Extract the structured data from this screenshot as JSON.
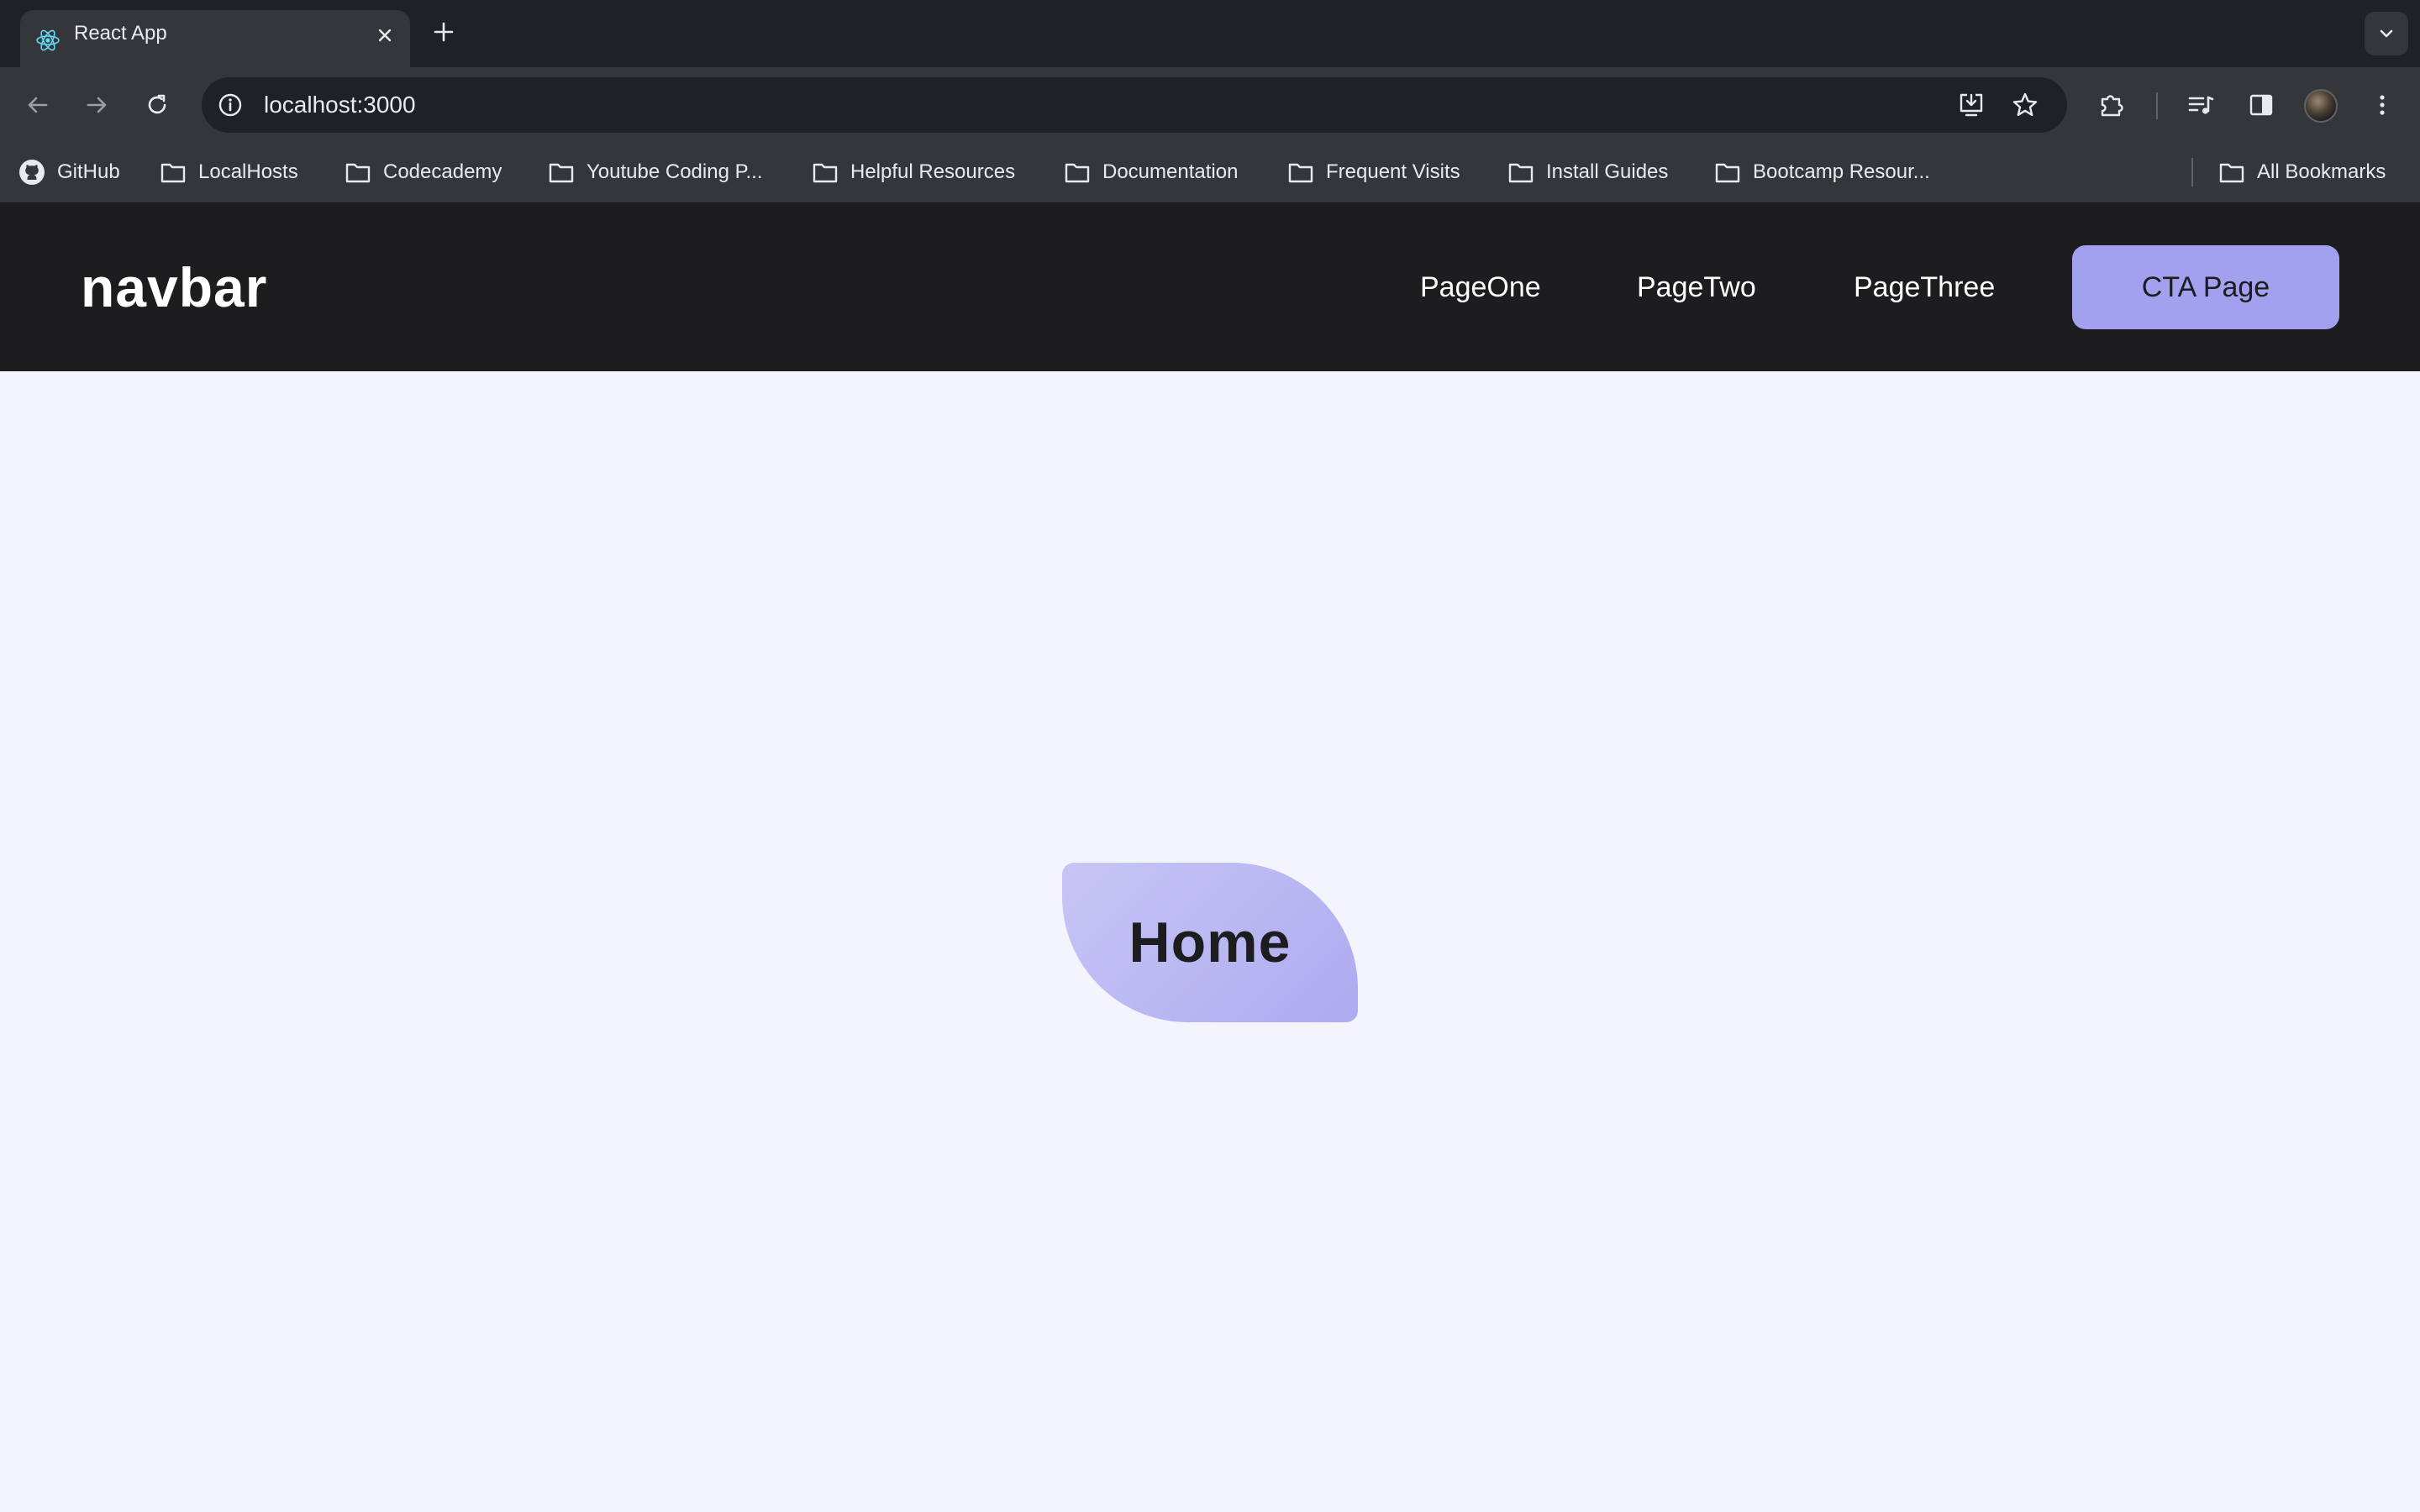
{
  "browser": {
    "tab": {
      "title": "React App",
      "favicon": "react-logo-icon"
    },
    "address_bar": {
      "url": "localhost:3000"
    },
    "bookmarks": [
      {
        "label": "GitHub",
        "icon": "github-icon"
      },
      {
        "label": "LocalHosts",
        "icon": "folder-icon"
      },
      {
        "label": "Codecademy",
        "icon": "folder-icon"
      },
      {
        "label": "Youtube Coding P...",
        "icon": "folder-icon"
      },
      {
        "label": "Helpful Resources",
        "icon": "folder-icon"
      },
      {
        "label": "Documentation",
        "icon": "folder-icon"
      },
      {
        "label": "Frequent Visits",
        "icon": "folder-icon"
      },
      {
        "label": "Install Guides",
        "icon": "folder-icon"
      },
      {
        "label": "Bootcamp Resour...",
        "icon": "folder-icon"
      }
    ],
    "all_bookmarks": {
      "label": "All Bookmarks",
      "icon": "folder-icon"
    }
  },
  "navbar": {
    "brand": "navbar",
    "links": [
      "PageOne",
      "PageTwo",
      "PageThree"
    ],
    "cta": "CTA Page"
  },
  "main": {
    "title": "Home"
  },
  "colors": {
    "nav_background": "#1d1d1f",
    "accent": "#a3a0ef",
    "page_background": "#f4f4fe"
  }
}
